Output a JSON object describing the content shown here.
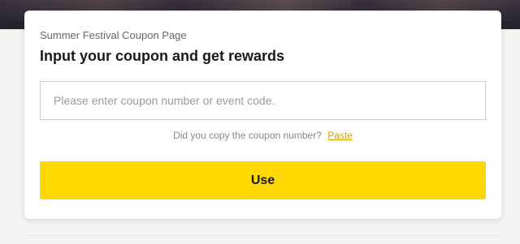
{
  "card": {
    "subtitle": "Summer Festival Coupon Page",
    "title": "Input your coupon and get rewards",
    "input": {
      "value": "",
      "placeholder": "Please enter coupon number or event code."
    },
    "paste_prompt": "Did you copy the coupon number?",
    "paste_link": "Paste",
    "use_button": "Use"
  },
  "colors": {
    "accent": "#ffd800",
    "link": "#e0a100",
    "banner": "#2a2733"
  }
}
